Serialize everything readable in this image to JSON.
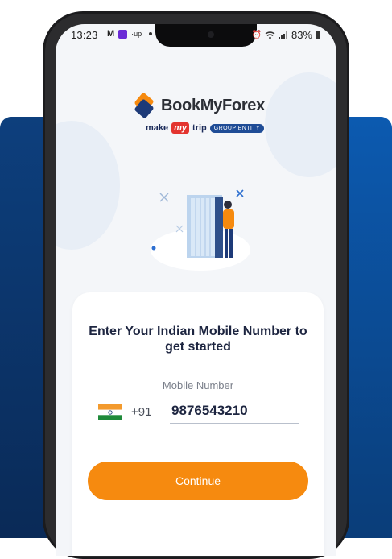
{
  "status_bar": {
    "time": "13:23",
    "battery": "83%",
    "icons": [
      "gmail-icon",
      "app-icon",
      "up-icon",
      "dot-icon",
      "alarm-icon",
      "wifi-icon",
      "signal-icon",
      "battery-icon"
    ]
  },
  "brand": {
    "name": "BookMyForex",
    "sub_make": "make",
    "sub_my": "my",
    "sub_trip": "trip",
    "group_badge": "GROUP ENTITY"
  },
  "login": {
    "title": "Enter Your Indian Mobile Number to get started",
    "mobile_label": "Mobile Number",
    "country_code": "+91",
    "mobile_value": "9876543210",
    "continue_label": "Continue"
  },
  "colors": {
    "accent_orange": "#f68a0f",
    "brand_navy": "#1d2540",
    "backdrop_blue": "#0c5ab0"
  }
}
